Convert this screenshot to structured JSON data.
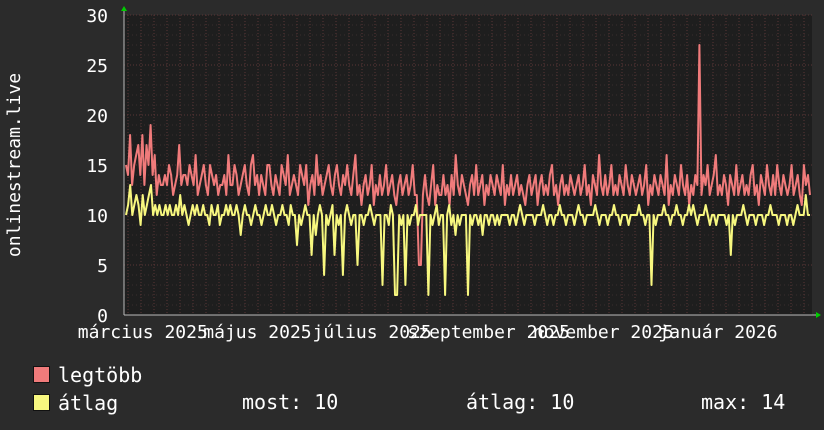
{
  "colors": {
    "background": "#2b2b2b",
    "plot_background": "#1e1e1e",
    "grid": "#5a3535",
    "max_series": "#f07b7b",
    "avg_series": "#f7f77f",
    "axis_arrow": "#00cc00"
  },
  "chart_data": {
    "type": "line",
    "ylabel": "onlinestream.live",
    "ylim": [
      0,
      30
    ],
    "yticks": [
      "0",
      "5",
      "10",
      "15",
      "20",
      "25",
      "30"
    ],
    "xticks": [
      "március 2025",
      "május 2025",
      "július 2025",
      "szeptember 2025",
      "november 2025",
      "január 2026"
    ],
    "grid": true,
    "x_start": "2025-02-19",
    "x_end": "2026-02-20",
    "series": [
      {
        "name": "legtöbb",
        "color": "#f07b7b",
        "values": [
          15,
          14,
          18,
          13,
          15,
          16,
          17,
          14,
          18,
          13,
          17,
          15,
          19,
          14,
          16,
          12,
          14,
          13,
          13,
          14,
          13,
          15,
          14,
          12,
          13,
          14,
          17,
          13,
          14,
          14,
          13,
          15,
          14,
          13,
          16,
          12,
          13,
          14,
          15,
          13,
          12,
          15,
          14,
          13,
          14,
          12,
          13,
          13,
          14,
          12,
          16,
          13,
          13,
          15,
          14,
          12,
          13,
          14,
          15,
          13,
          12,
          15,
          16,
          13,
          14,
          12,
          14,
          13,
          12,
          15,
          15,
          13,
          12,
          14,
          13,
          12,
          15,
          14,
          13,
          16,
          12,
          13,
          14,
          13,
          12,
          15,
          14,
          13,
          15,
          11,
          13,
          14,
          12,
          16,
          13,
          14,
          12,
          13,
          14,
          15,
          13,
          12,
          14,
          15,
          13,
          12,
          14,
          13,
          15,
          13,
          12,
          14,
          16,
          12,
          13,
          11,
          13,
          14,
          12,
          13,
          15,
          11,
          13,
          12,
          14,
          12,
          13,
          15,
          12,
          13,
          14,
          12,
          11,
          13,
          14,
          12,
          13,
          14,
          12,
          13,
          15,
          12,
          12,
          5,
          5,
          12,
          14,
          12,
          11,
          13,
          15,
          11,
          13,
          12,
          12,
          14,
          12,
          13,
          11,
          14,
          12,
          16,
          13,
          12,
          14,
          13,
          12,
          11,
          13,
          14,
          12,
          15,
          12,
          13,
          14,
          11,
          13,
          12,
          14,
          13,
          12,
          14,
          13,
          12,
          15,
          11,
          13,
          12,
          14,
          12,
          13,
          14,
          12,
          13,
          12,
          11,
          13,
          14,
          12,
          13,
          14,
          11,
          13,
          14,
          12,
          13,
          12,
          14,
          15,
          12,
          13,
          11,
          13,
          14,
          12,
          13,
          12,
          14,
          13,
          12,
          13,
          14,
          12,
          13,
          15,
          12,
          13,
          11,
          14,
          13,
          12,
          16,
          13,
          12,
          14,
          12,
          13,
          15,
          12,
          13,
          12,
          14,
          13,
          12,
          15,
          13,
          12,
          14,
          13,
          12,
          13,
          14,
          12,
          13,
          15,
          11,
          13,
          12,
          14,
          13,
          12,
          14,
          13,
          12,
          16,
          11,
          13,
          12,
          14,
          13,
          12,
          15,
          13,
          12,
          14,
          11,
          13,
          12,
          14,
          13,
          27,
          12,
          14,
          13,
          15,
          12,
          13,
          14,
          16,
          12,
          13,
          12,
          14,
          13,
          11,
          14,
          13,
          12,
          15,
          12,
          13,
          14,
          12,
          13,
          12,
          14,
          15,
          12,
          13,
          11,
          14,
          13,
          12,
          15,
          13,
          12,
          14,
          12,
          15,
          13,
          12,
          14,
          13,
          12,
          13,
          15,
          12,
          13,
          14,
          12,
          11,
          15,
          13,
          14,
          12
        ],
        "legend_label": "legtöbb"
      },
      {
        "name": "átlag",
        "color": "#f7f77f",
        "values": [
          10,
          11,
          13,
          10,
          11,
          12,
          11,
          9,
          12,
          10,
          11,
          12,
          13,
          10,
          11,
          10,
          11,
          10,
          10,
          11,
          10,
          11,
          10,
          10,
          11,
          10,
          12,
          10,
          11,
          10,
          9,
          10,
          11,
          10,
          11,
          10,
          10,
          11,
          10,
          10,
          9,
          11,
          10,
          10,
          11,
          9,
          10,
          10,
          11,
          10,
          11,
          10,
          10,
          11,
          10,
          8,
          10,
          11,
          10,
          10,
          9,
          10,
          11,
          10,
          10,
          9,
          10,
          11,
          10,
          10,
          11,
          10,
          9,
          10,
          10,
          11,
          10,
          10,
          9,
          11,
          10,
          10,
          7,
          10,
          9,
          10,
          11,
          10,
          10,
          6,
          10,
          8,
          10,
          11,
          10,
          4,
          10,
          9,
          10,
          11,
          6,
          10,
          9,
          10,
          4,
          10,
          11,
          10,
          9,
          10,
          10,
          5,
          10,
          10,
          9,
          10,
          10,
          11,
          10,
          9,
          10,
          10,
          10,
          3,
          10,
          10,
          9,
          11,
          10,
          2,
          2,
          10,
          9,
          10,
          3,
          10,
          9,
          10,
          10,
          11,
          9,
          10,
          10,
          10,
          10,
          2,
          10,
          9,
          10,
          11,
          9,
          10,
          10,
          2,
          10,
          11,
          9,
          10,
          8,
          10,
          9,
          10,
          10,
          10,
          2,
          10,
          9,
          10,
          10,
          9,
          10,
          8,
          10,
          10,
          9,
          10,
          10,
          9,
          10,
          9,
          10,
          10,
          10,
          10,
          9,
          10,
          10,
          9,
          10,
          11,
          10,
          9,
          10,
          10,
          10,
          10,
          9,
          10,
          10,
          10,
          11,
          10,
          9,
          10,
          10,
          9,
          10,
          10,
          11,
          10,
          10,
          9,
          10,
          10,
          10,
          9,
          10,
          11,
          10,
          10,
          9,
          10,
          10,
          10,
          10,
          11,
          10,
          9,
          10,
          10,
          10,
          9,
          10,
          10,
          11,
          10,
          10,
          9,
          10,
          10,
          10,
          9,
          10,
          10,
          10,
          10,
          11,
          10,
          10,
          9,
          10,
          10,
          3,
          10,
          9,
          10,
          10,
          10,
          11,
          10,
          10,
          9,
          10,
          10,
          11,
          10,
          10,
          9,
          10,
          10,
          11,
          10,
          11,
          10,
          9,
          10,
          10,
          10,
          11,
          10,
          9,
          10,
          10,
          9,
          10,
          10,
          10,
          10,
          9,
          10,
          6,
          10,
          9,
          10,
          10,
          10,
          11,
          10,
          9,
          10,
          10,
          10,
          9,
          10,
          10,
          10,
          9,
          10,
          10,
          11,
          10,
          10,
          10,
          9,
          10,
          10,
          10,
          9,
          10,
          10,
          9,
          10,
          11,
          10,
          10,
          10,
          12,
          10,
          10
        ],
        "legend_label": "átlag"
      }
    ]
  },
  "legend": {
    "max_label": "legtöbb",
    "avg_label": "átlag"
  },
  "stats": {
    "now": "most: 10",
    "avg": "átlag: 10",
    "max": "max: 14"
  }
}
